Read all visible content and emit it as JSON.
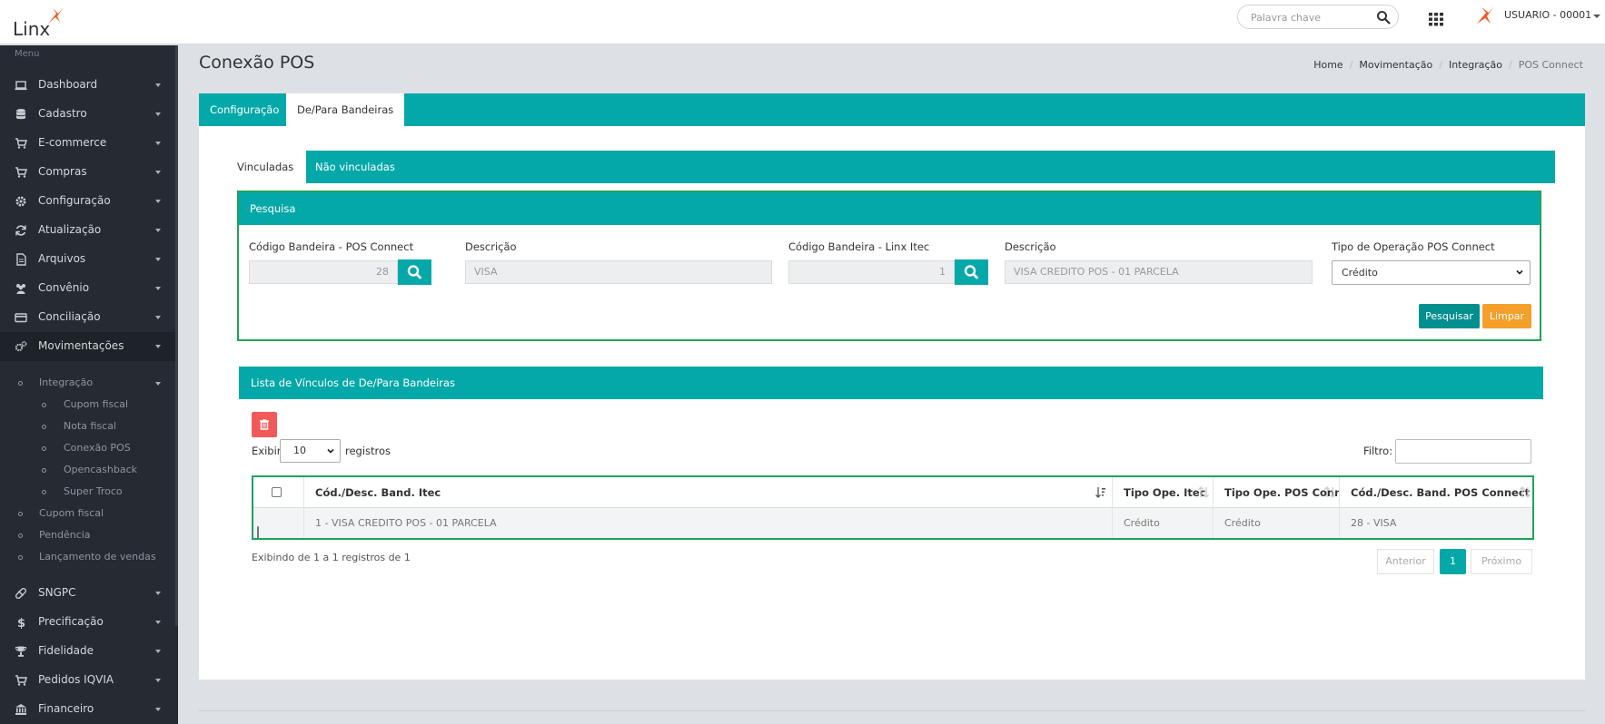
{
  "header": {
    "logo_text": "Linx",
    "search_placeholder": "Palavra chave",
    "user_name": "USUARIO - 00001"
  },
  "sidebar": {
    "menu_label": "Menu",
    "items": [
      {
        "label": "Dashboard",
        "icon": "laptop-icon"
      },
      {
        "label": "Cadastro",
        "icon": "database-icon"
      },
      {
        "label": "E-commerce",
        "icon": "cart-icon"
      },
      {
        "label": "Compras",
        "icon": "cart-icon"
      },
      {
        "label": "Configuração",
        "icon": "gear-icon"
      },
      {
        "label": "Atualização",
        "icon": "refresh-icon"
      },
      {
        "label": "Arquivos",
        "icon": "file-icon"
      },
      {
        "label": "Convênio",
        "icon": "users-icon"
      },
      {
        "label": "Conciliação",
        "icon": "credit-card-icon"
      },
      {
        "label": "Movimentações",
        "icon": "gears-icon"
      }
    ],
    "submenu": [
      {
        "label": "Integração",
        "level": 1
      },
      {
        "label": "Cupom fiscal",
        "level": 2
      },
      {
        "label": "Nota fiscal",
        "level": 2
      },
      {
        "label": "Conexão POS",
        "level": 2
      },
      {
        "label": "Opencashback",
        "level": 2
      },
      {
        "label": "Super Troco",
        "level": 2
      },
      {
        "label": "Cupom fiscal",
        "level": 1
      },
      {
        "label": "Pendência",
        "level": 1
      },
      {
        "label": "Lançamento de vendas",
        "level": 1
      }
    ],
    "items_after": [
      {
        "label": "SNGPC",
        "icon": "pill-icon"
      },
      {
        "label": "Precificação",
        "icon": "dollar-icon"
      },
      {
        "label": "Fidelidade",
        "icon": "trophy-icon"
      },
      {
        "label": "Pedidos IQVIA",
        "icon": "cart-icon"
      },
      {
        "label": "Financeiro",
        "icon": "bank-icon"
      }
    ]
  },
  "page": {
    "title": "Conexão POS",
    "breadcrumb": [
      "Home",
      "Movimentação",
      "Integração",
      "POS Connect"
    ]
  },
  "tabs": [
    "Configuração",
    "De/Para Bandeiras"
  ],
  "subtabs": [
    "Vinculadas",
    "Não vinculadas"
  ],
  "pesquisa": {
    "title": "Pesquisa",
    "cod_pos_label": "Código Bandeira - POS Connect",
    "cod_pos_value": "28",
    "desc1_label": "Descrição",
    "desc1_value": "VISA",
    "cod_linx_label": "Código Bandeira - Linx Itec",
    "cod_linx_value": "1",
    "desc2_label": "Descrição",
    "desc2_value": "VISA CREDITO POS - 01 PARCELA",
    "tipo_label": "Tipo de Operação POS Connect",
    "tipo_value": "Crédito",
    "btn_pesquisar": "Pesquisar",
    "btn_limpar": "Limpar"
  },
  "lista": {
    "title": "Lista de Vínculos de De/Para Bandeiras",
    "exibir": "Exibir",
    "page_length": "10",
    "registros": "registros",
    "filtro": "Filtro:",
    "columns": [
      "Cód./Desc. Band. Itec",
      "Tipo Ope. Itec",
      "Tipo Ope. POS Connect",
      "Cód./Desc. Band. POS Connect"
    ],
    "rows": [
      [
        "1 - VISA CREDITO POS - 01 PARCELA",
        "Crédito",
        "Crédito",
        "28 - VISA"
      ]
    ],
    "info": "Exibindo de 1 a 1 registros de 1",
    "pager": {
      "prev": "Anterior",
      "current": "1",
      "next": "Próximo"
    }
  },
  "colors": {
    "teal": "#05a8a8",
    "sidebar": "#262b33",
    "highlight_border": "#1fa35a",
    "limpar": "#f4a02a",
    "delete": "#f25a5a"
  }
}
